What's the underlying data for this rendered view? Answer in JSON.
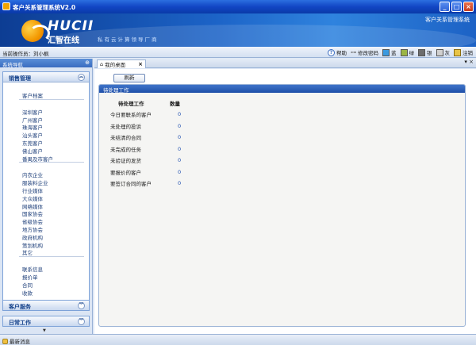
{
  "window": {
    "title": "客户关系管理系统V2.0",
    "minimize": "_",
    "maximize": "□",
    "close": "×"
  },
  "banner": {
    "logo_en": "HUCII",
    "logo_cn": "汇智在线",
    "slogan": "私有云计算领导厂商",
    "system_name": "客户关系管理系统"
  },
  "toolbar": {
    "operator_label": "当前操作员：",
    "operator_name": "刘小枫",
    "help": "帮助",
    "change_password": "修改密码",
    "themes": [
      {
        "label": "蓝",
        "color": "#3b9ae0"
      },
      {
        "label": "绿",
        "color": "#9bb545"
      },
      {
        "label": "银",
        "color": "#6d6d6d"
      },
      {
        "label": "灰",
        "color": "#d0d0d0"
      }
    ],
    "exit": "注销"
  },
  "sidebar": {
    "title": "系统导航",
    "panels": {
      "sales": {
        "title": "销售管理",
        "groups": [
          [
            "客户档案"
          ],
          [
            "深圳客户",
            "广州客户",
            "珠海客户",
            "汕头客户",
            "东莞客户",
            "佛山客户",
            "番禺及市客户"
          ],
          [
            "内衣企业",
            "服装料企业",
            "行业媒体",
            "大众媒体",
            "网络媒体",
            "国家协会",
            "省级协会",
            "地方协会",
            "政府机构",
            "策划机构",
            "其它"
          ],
          [
            "联系信息",
            "报价单",
            "合同",
            "收款"
          ]
        ]
      },
      "service": {
        "title": "客户服务"
      },
      "daily": {
        "title": "日常工作"
      }
    }
  },
  "tabs": [
    {
      "label": "我的桌面",
      "close": "×"
    }
  ],
  "main": {
    "refresh": "刷新",
    "pending_title": "待处理工作",
    "table": {
      "headers": [
        "待处理工作",
        "数量"
      ],
      "rows": [
        [
          "今日要联系的客户",
          "0"
        ],
        [
          "未处理的投诉",
          "0"
        ],
        [
          "未结清的合同",
          "0"
        ],
        [
          "未完成的任务",
          "0"
        ],
        [
          "未验证的发货",
          "0"
        ],
        [
          "要报价的客户",
          "0"
        ],
        [
          "要签订合同的客户",
          "0"
        ]
      ]
    }
  },
  "status": {
    "latest_message": "最新消息"
  }
}
